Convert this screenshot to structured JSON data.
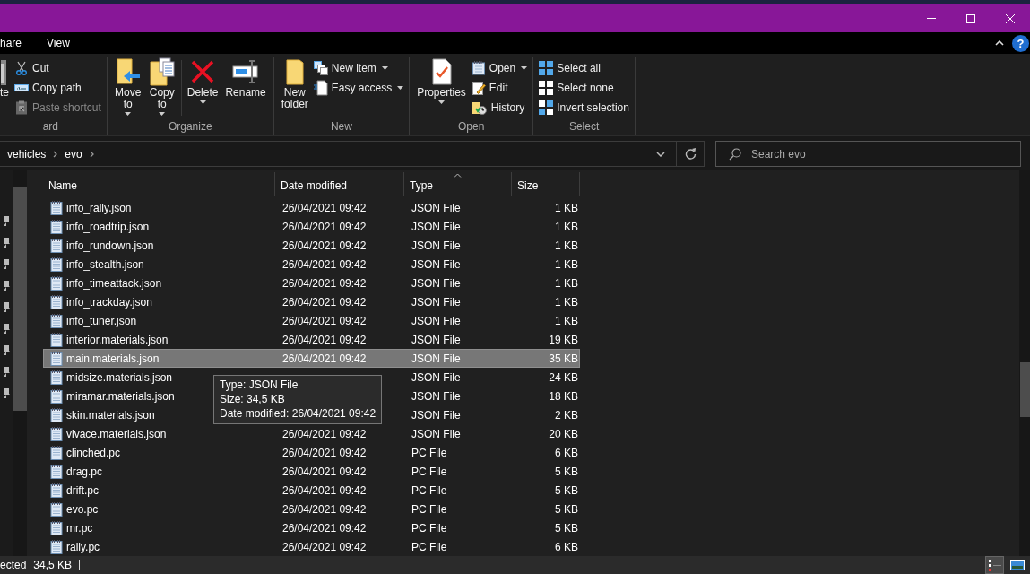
{
  "menu_tabs": [
    {
      "label": "hare",
      "selected": false
    },
    {
      "label": "View",
      "selected": false
    }
  ],
  "help_button": "?",
  "ribbon": {
    "groups": [
      {
        "label": "ard",
        "items": [
          {
            "kind": "large",
            "label": "te",
            "dropdown": false,
            "disabled": false
          },
          {
            "kind": "small",
            "label": "Cut",
            "dropdown": false,
            "disabled": false
          },
          {
            "kind": "small",
            "label": "Copy path",
            "dropdown": false,
            "disabled": false
          },
          {
            "kind": "small",
            "label": "Paste shortcut",
            "dropdown": false,
            "disabled": true
          }
        ]
      },
      {
        "label": "Organize",
        "items": [
          {
            "kind": "large",
            "label": "Move to",
            "dropdown": true,
            "disabled": false
          },
          {
            "kind": "large",
            "label": "Copy to",
            "dropdown": true,
            "disabled": false
          },
          {
            "kind": "divider"
          },
          {
            "kind": "large",
            "label": "Delete",
            "dropdown": true,
            "disabled": false
          },
          {
            "kind": "large",
            "label": "Rename",
            "dropdown": false,
            "disabled": false
          }
        ]
      },
      {
        "label": "New",
        "items": [
          {
            "kind": "large",
            "label": "New folder",
            "dropdown": false,
            "disabled": false
          },
          {
            "kind": "small",
            "label": "New item",
            "dropdown": true,
            "disabled": false
          },
          {
            "kind": "small",
            "label": "Easy access",
            "dropdown": true,
            "disabled": false
          }
        ]
      },
      {
        "label": "Open",
        "items": [
          {
            "kind": "large",
            "label": "Properties",
            "dropdown": true,
            "disabled": false
          },
          {
            "kind": "small",
            "label": "Open",
            "dropdown": true,
            "disabled": false
          },
          {
            "kind": "small",
            "label": "Edit",
            "dropdown": false,
            "disabled": false
          },
          {
            "kind": "small",
            "label": "History",
            "dropdown": false,
            "disabled": false
          }
        ]
      },
      {
        "label": "Select",
        "items": [
          {
            "kind": "small",
            "label": "Select all",
            "dropdown": false,
            "disabled": false
          },
          {
            "kind": "small",
            "label": "Select none",
            "dropdown": false,
            "disabled": false
          },
          {
            "kind": "small",
            "label": "Invert selection",
            "dropdown": false,
            "disabled": false
          }
        ]
      }
    ]
  },
  "address_bar": {
    "crumbs": [
      "vehicles",
      "evo"
    ]
  },
  "search": {
    "placeholder": "Search evo"
  },
  "file_list": {
    "columns": [
      {
        "label": "Name",
        "sorted": false
      },
      {
        "label": "Date modified",
        "sorted": false
      },
      {
        "label": "Type",
        "sorted": true
      },
      {
        "label": "Size",
        "sorted": false
      }
    ],
    "rows": [
      {
        "name": "info_rally.json",
        "date": "26/04/2021 09:42",
        "type": "JSON File",
        "size": "1 KB",
        "selected": false
      },
      {
        "name": "info_roadtrip.json",
        "date": "26/04/2021 09:42",
        "type": "JSON File",
        "size": "1 KB",
        "selected": false
      },
      {
        "name": "info_rundown.json",
        "date": "26/04/2021 09:42",
        "type": "JSON File",
        "size": "1 KB",
        "selected": false
      },
      {
        "name": "info_stealth.json",
        "date": "26/04/2021 09:42",
        "type": "JSON File",
        "size": "1 KB",
        "selected": false
      },
      {
        "name": "info_timeattack.json",
        "date": "26/04/2021 09:42",
        "type": "JSON File",
        "size": "1 KB",
        "selected": false
      },
      {
        "name": "info_trackday.json",
        "date": "26/04/2021 09:42",
        "type": "JSON File",
        "size": "1 KB",
        "selected": false
      },
      {
        "name": "info_tuner.json",
        "date": "26/04/2021 09:42",
        "type": "JSON File",
        "size": "1 KB",
        "selected": false
      },
      {
        "name": "interior.materials.json",
        "date": "26/04/2021 09:42",
        "type": "JSON File",
        "size": "19 KB",
        "selected": false
      },
      {
        "name": "main.materials.json",
        "date": "26/04/2021 09:42",
        "type": "JSON File",
        "size": "35 KB",
        "selected": true
      },
      {
        "name": "midsize.materials.json",
        "type": "JSON File",
        "size": "24 KB",
        "selected": false
      },
      {
        "name": "miramar.materials.json",
        "type": "JSON File",
        "size": "18 KB",
        "selected": false
      },
      {
        "name": "skin.materials.json",
        "type": "JSON File",
        "size": "2 KB",
        "selected": false
      },
      {
        "name": "vivace.materials.json",
        "date": "26/04/2021 09:42",
        "type": "JSON File",
        "size": "20 KB",
        "selected": false
      },
      {
        "name": "clinched.pc",
        "date": "26/04/2021 09:42",
        "type": "PC File",
        "size": "6 KB",
        "selected": false
      },
      {
        "name": "drag.pc",
        "date": "26/04/2021 09:42",
        "type": "PC File",
        "size": "5 KB",
        "selected": false
      },
      {
        "name": "drift.pc",
        "date": "26/04/2021 09:42",
        "type": "PC File",
        "size": "5 KB",
        "selected": false
      },
      {
        "name": "evo.pc",
        "date": "26/04/2021 09:42",
        "type": "PC File",
        "size": "5 KB",
        "selected": false
      },
      {
        "name": "mr.pc",
        "date": "26/04/2021 09:42",
        "type": "PC File",
        "size": "5 KB",
        "selected": false
      },
      {
        "name": "rally.pc",
        "date": "26/04/2021 09:42",
        "type": "PC File",
        "size": "6 KB",
        "selected": false
      }
    ]
  },
  "tooltip": {
    "lines": [
      "Type: JSON File",
      "Size: 34,5 KB",
      "Date modified: 26/04/2021 09:42"
    ]
  },
  "status_bar": {
    "selection": "ected",
    "size": "34,5 KB",
    "view_buttons": [
      {
        "selected": true
      },
      {
        "selected": false
      }
    ]
  }
}
